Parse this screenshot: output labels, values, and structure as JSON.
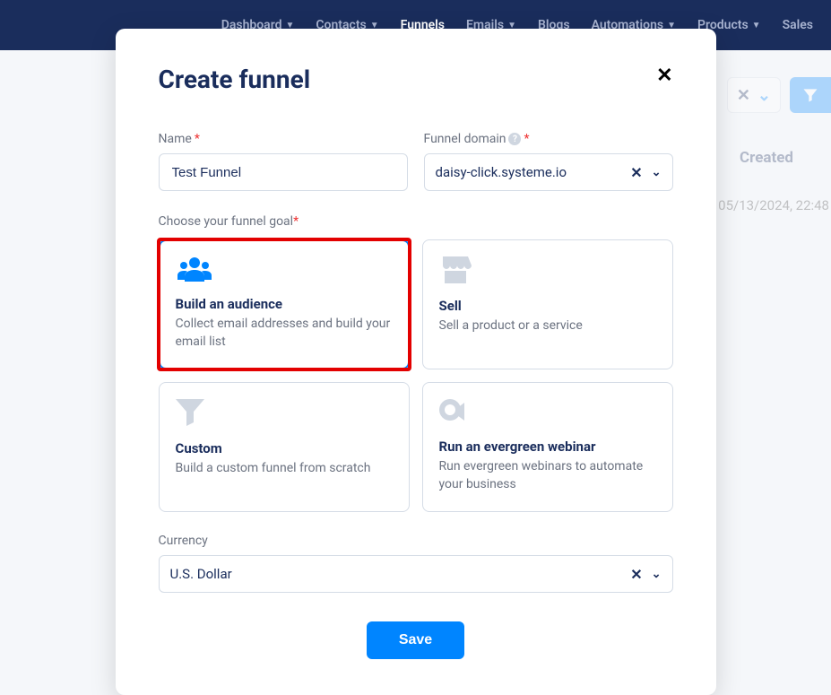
{
  "nav": {
    "items": [
      {
        "label": "Dashboard",
        "hasChevron": true
      },
      {
        "label": "Contacts",
        "hasChevron": true
      },
      {
        "label": "Funnels",
        "hasChevron": false,
        "active": true
      },
      {
        "label": "Emails",
        "hasChevron": true
      },
      {
        "label": "Blogs",
        "hasChevron": false
      },
      {
        "label": "Automations",
        "hasChevron": true
      },
      {
        "label": "Products",
        "hasChevron": true
      },
      {
        "label": "Sales",
        "hasChevron": false
      }
    ]
  },
  "background": {
    "table_header": "Created",
    "table_row_value": "05/13/2024, 22:48"
  },
  "modal": {
    "title": "Create funnel",
    "name_label": "Name",
    "name_value": "Test Funnel",
    "domain_label": "Funnel domain",
    "domain_value": "daisy-click.systeme.io",
    "goal_label": "Choose your funnel goal",
    "goals": [
      {
        "title": "Build an audience",
        "desc": "Collect email addresses and build your email list",
        "selected": true,
        "icon": "audience"
      },
      {
        "title": "Sell",
        "desc": "Sell a product or a service",
        "selected": false,
        "icon": "store"
      },
      {
        "title": "Custom",
        "desc": "Build a custom funnel from scratch",
        "selected": false,
        "icon": "funnel"
      },
      {
        "title": "Run an evergreen webinar",
        "desc": "Run evergreen webinars to automate your business",
        "selected": false,
        "icon": "webinar"
      }
    ],
    "currency_label": "Currency",
    "currency_value": "U.S. Dollar",
    "save_label": "Save"
  }
}
